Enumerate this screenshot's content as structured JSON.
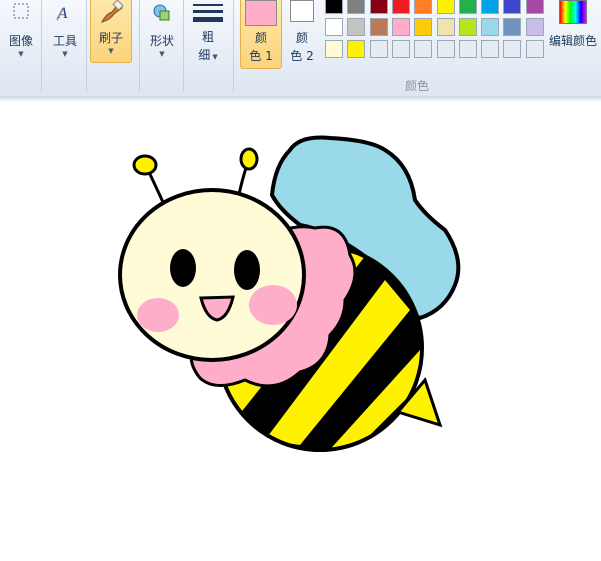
{
  "ribbon": {
    "image_label": "图像",
    "tools_label": "工具",
    "brushes_label": "刷子",
    "shapes_label": "形状",
    "size_label_line1": "粗",
    "size_label_line2": "细",
    "color1_line1": "颜",
    "color1_line2": "色 1",
    "color2_line1": "颜",
    "color2_line2": "色 2",
    "edit_colors_label": "编辑颜色",
    "colors_group_label": "颜色"
  },
  "palette": {
    "row1": [
      "#000000",
      "#7f7f7f",
      "#880015",
      "#ed1c24",
      "#ff7f27",
      "#fff200",
      "#22b14c",
      "#00a2e8",
      "#3f48cc",
      "#a349a4"
    ],
    "row2": [
      "#ffffff",
      "#c3c3c3",
      "#b97a57",
      "#ffaec9",
      "#ffc90e",
      "#efe4b0",
      "#b5e61d",
      "#99d9ea",
      "#7092be",
      "#c8bfe7"
    ],
    "row3": [
      "#fffbd6",
      "#fff200",
      "#e7ecf2",
      "#e7ecf2",
      "#e7ecf2",
      "#e7ecf2",
      "#e7ecf2",
      "#e7ecf2",
      "#e7ecf2",
      "#e7ecf2"
    ],
    "color1": "#ffaec9",
    "color2": "#ffffff"
  },
  "canvas": {
    "drawing_colors": {
      "outline": "#000000",
      "head": "#fffbd6",
      "cheeks": "#ffaec9",
      "wing": "#99d9ea",
      "stripes": "#fff200",
      "antenna_tips": "#fff200"
    }
  }
}
